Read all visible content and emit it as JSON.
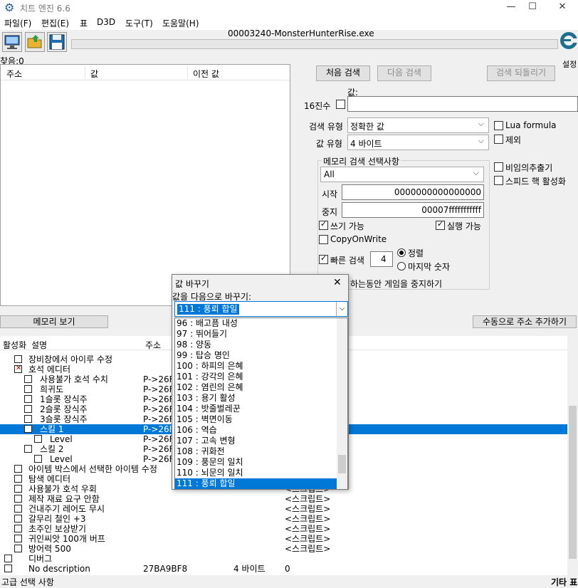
{
  "window": {
    "title": "치트 엔진 6.6",
    "minimize": "—",
    "maximize": "☐",
    "close": "✕"
  },
  "menu": [
    "파일(F)",
    "편집(E)",
    "표",
    "D3D",
    "도구(T)",
    "도움말(H)"
  ],
  "process_name": "00003240-MonsterHunterRise.exe",
  "found_label": "찾음:0",
  "settings_label": "설정",
  "results_table": {
    "headers": [
      "주소",
      "값",
      "이전 값"
    ]
  },
  "scan": {
    "first_scan": "처음 검색",
    "next_scan": "다음 검색",
    "undo_scan": "검색 되돌리기",
    "value_label": "값:",
    "hex_label": "16진수",
    "value": "",
    "scan_type_label": "검색 유형",
    "scan_type_value": "정확한 값",
    "value_type_label": "값 유형",
    "value_type_value": "4 바이트",
    "lua_formula": "Lua formula",
    "not_label": "제외",
    "unrandomizer": "비임의추출기",
    "speedhack": "스피드 핵 활성화",
    "memory_options_label": "메모리 검색 선택사항",
    "region": "All",
    "start_label": "시작",
    "start_value": "0000000000000000",
    "stop_label": "중지",
    "stop_value": "00007fffffffffff",
    "writable": "쓰기 가능",
    "executable": "실행 가능",
    "copyonwrite": "CopyOnWrite",
    "fast_scan": "빠른 검색",
    "fast_scan_value": "4",
    "alignment": "정렬",
    "last_digits": "마지막 숫자",
    "pause_game": "하는동안 게임을 중지하기"
  },
  "memory_view_button": "메모리 보기",
  "add_address_button": "수동으로 주소 추가하기",
  "address_list": {
    "headers": [
      "활성화",
      "설명",
      "주소"
    ],
    "rows": [
      {
        "desc": "장비창에서 아이루 수정",
        "addr": "",
        "type": "",
        "value": ""
      },
      {
        "desc": "호석 에디터",
        "addr": "",
        "type": "",
        "value": ""
      },
      {
        "desc": "사용불가 호석 수치",
        "addr": "P->26F",
        "type": "",
        "value": ""
      },
      {
        "desc": "희귀도",
        "addr": "P->26F",
        "type": "",
        "value": ""
      },
      {
        "desc": "1슬롯 장식주",
        "addr": "P->26F",
        "type": "",
        "value": ""
      },
      {
        "desc": "2슬롯 장식주",
        "addr": "P->26F",
        "type": "",
        "value": ""
      },
      {
        "desc": "3슬롯 장식주",
        "addr": "P->26F",
        "type": "",
        "value": ""
      },
      {
        "desc": "스킬 1",
        "addr": "P->26F",
        "type": "",
        "value": ""
      },
      {
        "desc": "Level",
        "addr": "P->26F",
        "type": "",
        "value": ""
      },
      {
        "desc": "스킬 2",
        "addr": "P->26F",
        "type": "",
        "value": ""
      },
      {
        "desc": "Level",
        "addr": "P->26F",
        "type": "",
        "value": ""
      },
      {
        "desc": "아이템 박스에서 선택한 아이템 수정",
        "addr": "",
        "type": "",
        "value": ""
      },
      {
        "desc": "탐색 에디터",
        "addr": "",
        "type": "",
        "value": ""
      },
      {
        "desc": "사용불가 호석 우회",
        "addr": "",
        "type": "",
        "value": "<스크립트>"
      },
      {
        "desc": "제작 재료 요구 안함",
        "addr": "",
        "type": "",
        "value": "<스크립트>"
      },
      {
        "desc": "건내주기 레어도 무시",
        "addr": "",
        "type": "",
        "value": "<스크립트>"
      },
      {
        "desc": "갈무리 철인 +3",
        "addr": "",
        "type": "",
        "value": "<스크립트>"
      },
      {
        "desc": "초주인 보상받기",
        "addr": "",
        "type": "",
        "value": "<스크립트>"
      },
      {
        "desc": "귀인씨앗 100개 버프",
        "addr": "",
        "type": "",
        "value": "<스크립트>"
      },
      {
        "desc": "방어력 500",
        "addr": "",
        "type": "",
        "value": "<스크립트>"
      },
      {
        "desc": "디버그",
        "addr": "",
        "type": "",
        "value": ""
      },
      {
        "desc": "No description",
        "addr": "27BA9BF8",
        "type": "4 바이트",
        "value": "0"
      }
    ]
  },
  "status": {
    "left": "고급 선택 사항",
    "right": "기타 표"
  },
  "dialog": {
    "title": "값 바꾸기",
    "close": "✕",
    "prompt": "값을 다음으로 바꾸기:",
    "selected": "111 : 풍뢰 합일",
    "options": [
      "96 : 배고픔 내성",
      "97 : 뛰어들기",
      "98 : 양동",
      "99 : 탑승 명인",
      "100 : 하피의 은혜",
      "101 : 강각의 은혜",
      "102 : 염린의 은혜",
      "103 : 용기 활성",
      "104 : 밧줄벌레꾼",
      "105 : 벽면이동",
      "106 : 역습",
      "107 : 고속 변형",
      "108 : 귀화전",
      "109 : 풍문의 일치",
      "110 : 뇌문의 일치",
      "111 : 풍뢰 합일"
    ]
  },
  "icons": {
    "process": "computer-icon",
    "open": "folder-open-icon",
    "save": "floppy-save-icon",
    "logo": "cheat-engine-logo-icon"
  },
  "colors": {
    "selection": "#0078d7",
    "title_icon": "#2a5ea6"
  }
}
